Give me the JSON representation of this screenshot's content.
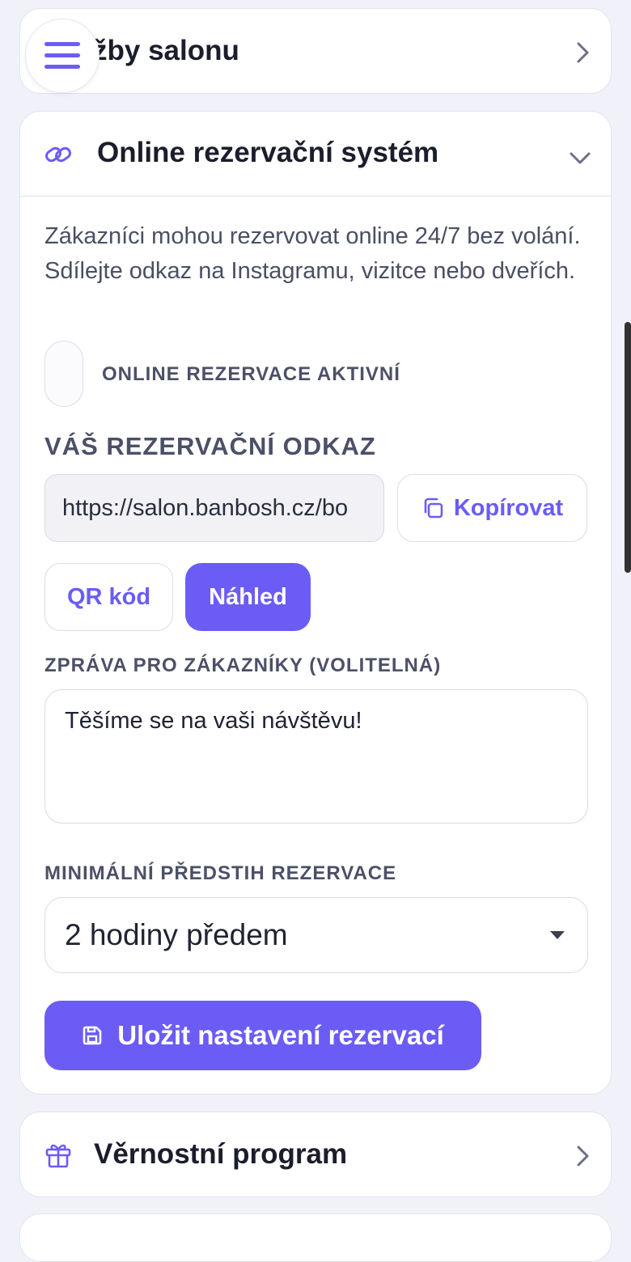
{
  "colors": {
    "accent": "#6b5cf6",
    "background": "#f1f1f9"
  },
  "sections": {
    "services": {
      "title": "Služby salonu",
      "visible_title": "žby salonu",
      "icon": "chevron-right-icon"
    },
    "online_booking": {
      "title": "Online rezervační systém",
      "icon": "link-icon",
      "description": "Zákazníci mohou rezervovat online 24/7 bez volání. Sdílejte odkaz na Instagramu, vizitce nebo dveřích.",
      "toggle_label": "ONLINE REZERVACE AKTIVNÍ",
      "toggle_on": false,
      "link_label": "VÁŠ REZERVAČNÍ ODKAZ",
      "link_value": "https://salon.banbosh.cz/bo",
      "copy_label": "Kopírovat",
      "qr_label": "QR kód",
      "preview_label": "Náhled",
      "message_label": "ZPRÁVA PRO ZÁKAZNÍKY (VOLITELNÁ)",
      "message_value": "Těšíme se na vaši návštěvu!",
      "lead_time_label": "MINIMÁLNÍ PŘEDSTIH REZERVACE",
      "lead_time_value": "2 hodiny předem",
      "save_label": "Uložit nastavení rezervací"
    },
    "loyalty": {
      "title": "Věrnostní program",
      "icon": "gift-icon"
    }
  }
}
